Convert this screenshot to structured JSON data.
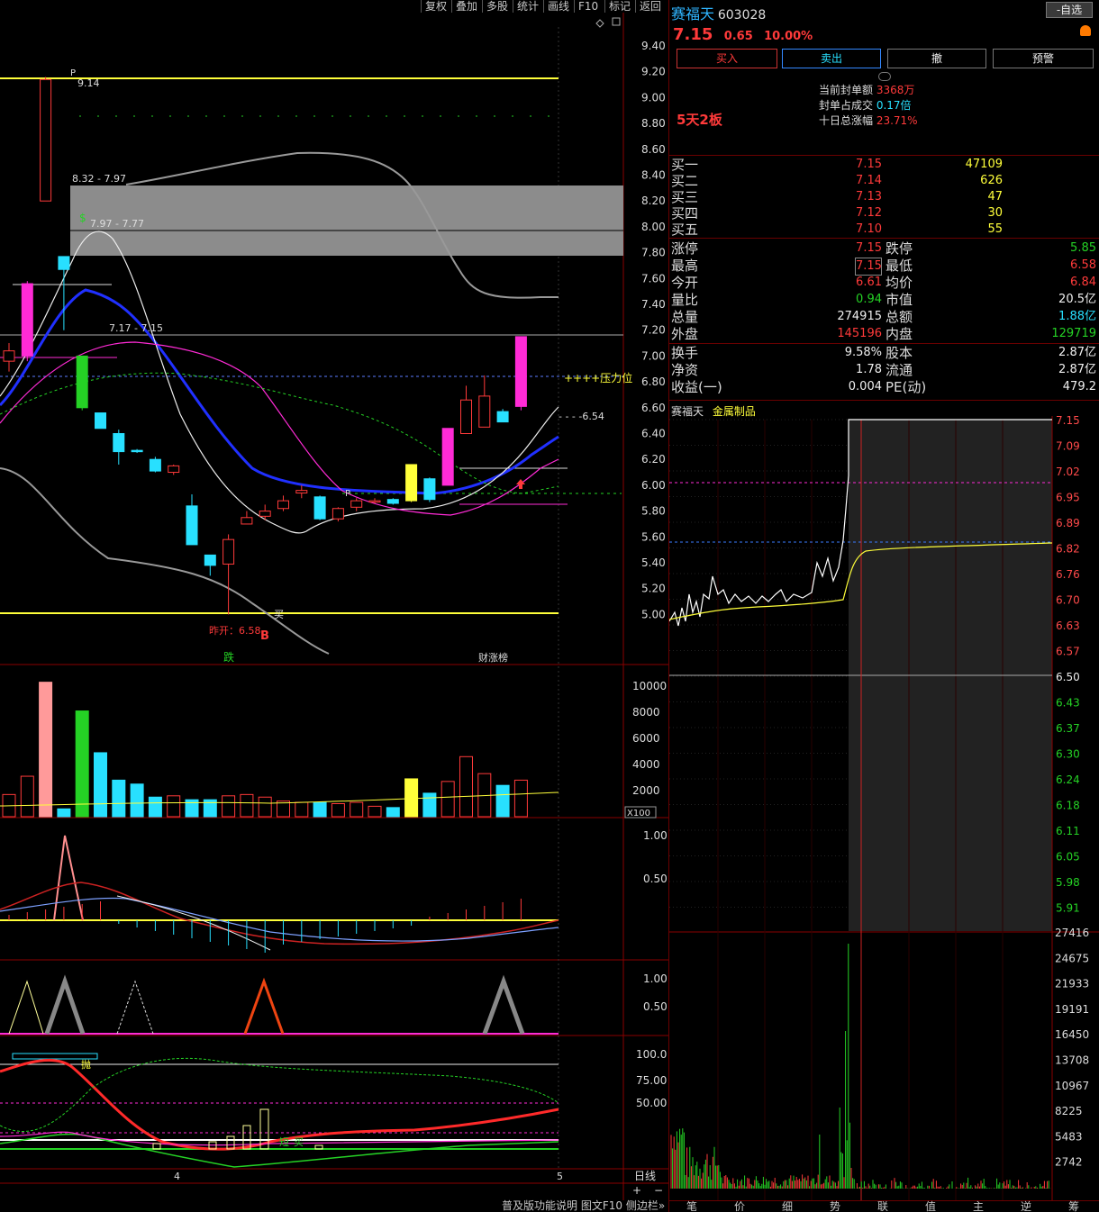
{
  "menu": [
    "复权",
    "叠加",
    "多股",
    "统计",
    "画线",
    "F10",
    "标记",
    "返回"
  ],
  "stock": {
    "name": "赛福天",
    "code": "603028",
    "price": "7.15",
    "change": "0.65",
    "change_pct": "10.00%",
    "self_select": "-自选",
    "board_tag": "5天2板",
    "industry": "金属制品"
  },
  "trade_buttons": [
    "买入",
    "卖出",
    "撤",
    "预警"
  ],
  "seal_info": [
    {
      "label": "当前封单额",
      "value": "3368万"
    },
    {
      "label": "封单占成交",
      "value": "0.17倍"
    },
    {
      "label": "十日总涨幅",
      "value": "23.71%"
    }
  ],
  "bids": [
    {
      "label": "买一",
      "price": "7.15",
      "vol": "47109"
    },
    {
      "label": "买二",
      "price": "7.14",
      "vol": "626"
    },
    {
      "label": "买三",
      "price": "7.13",
      "vol": "47"
    },
    {
      "label": "买四",
      "price": "7.12",
      "vol": "30"
    },
    {
      "label": "买五",
      "price": "7.10",
      "vol": "55"
    }
  ],
  "quote_rows": [
    {
      "l1": "涨停",
      "v1": "7.15",
      "l2": "跌停",
      "v2": "5.85"
    },
    {
      "l1": "最高",
      "v1": "7.15",
      "l2": "最低",
      "v2": "6.58"
    },
    {
      "l1": "今开",
      "v1": "6.61",
      "l2": "均价",
      "v2": "6.84"
    },
    {
      "l1": "量比",
      "v1": "0.94",
      "l2": "市值",
      "v2": "20.5亿"
    },
    {
      "l1": "总量",
      "v1": "274915",
      "l2": "总额",
      "v2": "1.88亿"
    },
    {
      "l1": "外盘",
      "v1": "145196",
      "l2": "内盘",
      "v2": "129719"
    }
  ],
  "fund_rows": [
    {
      "l1": "换手",
      "v1": "9.58%",
      "l2": "股本",
      "v2": "2.87亿"
    },
    {
      "l1": "净资",
      "v1": "1.78",
      "l2": "流通",
      "v2": "2.87亿"
    },
    {
      "l1": "收益(一)",
      "v1": "0.004",
      "l2": "PE(动)",
      "v2": "479.2"
    }
  ],
  "kline": {
    "price_axis": [
      "9.40",
      "9.20",
      "9.00",
      "8.80",
      "8.60",
      "8.40",
      "8.20",
      "8.00",
      "7.80",
      "7.60",
      "7.40",
      "7.20",
      "7.00",
      "6.80",
      "6.60",
      "6.40",
      "6.20",
      "6.00",
      "5.80",
      "5.60",
      "5.40",
      "5.20",
      "5.00"
    ],
    "annotations": {
      "high": "9.14",
      "zone1": "8.32 - 7.97",
      "zone2": "7.97 - 7.77",
      "zone3": "7.17 - 7.15",
      "pressure": "++++压力位",
      "support": "6.54",
      "prev_open": "昨开：6.58",
      "buy_mark": "买",
      "b_mark": "B",
      "fall_tag": "跌",
      "rise_tag": "财涨榜",
      "p_mark": "P",
      "dollar": "$"
    },
    "candles": [
      [
        6.96,
        7.04,
        7.1,
        6.88
      ],
      [
        7.0,
        7.56,
        7.58,
        6.96
      ],
      [
        8.2,
        9.14,
        9.16,
        8.2
      ],
      [
        7.77,
        7.67,
        7.77,
        7.2
      ],
      [
        7.0,
        6.6,
        7.0,
        6.58
      ],
      [
        6.56,
        6.44,
        6.56,
        6.44
      ],
      [
        6.4,
        6.26,
        6.43,
        6.16
      ],
      [
        6.27,
        6.26,
        6.28,
        6.25
      ],
      [
        6.2,
        6.11,
        6.22,
        6.1
      ],
      [
        6.1,
        6.15,
        6.16,
        6.08
      ],
      [
        5.84,
        5.54,
        5.93,
        5.54
      ],
      [
        5.46,
        5.38,
        5.46,
        5.3
      ],
      [
        5.39,
        5.58,
        5.62,
        5.0
      ],
      [
        5.7,
        5.75,
        5.8,
        5.7
      ],
      [
        5.76,
        5.8,
        5.85,
        5.73
      ],
      [
        5.82,
        5.88,
        5.92,
        5.8
      ],
      [
        5.94,
        5.96,
        6.0,
        5.9
      ],
      [
        5.91,
        5.74,
        5.92,
        5.73
      ],
      [
        5.74,
        5.82,
        5.83,
        5.72
      ],
      [
        5.83,
        5.88,
        5.9,
        5.8
      ],
      [
        5.88,
        5.88,
        5.9,
        5.86
      ],
      [
        5.89,
        5.86,
        5.9,
        5.85
      ],
      [
        5.88,
        6.16,
        6.16,
        5.87
      ],
      [
        6.05,
        5.89,
        6.06,
        5.87
      ],
      [
        6.0,
        6.44,
        6.44,
        6.0
      ],
      [
        6.4,
        6.66,
        6.77,
        6.4
      ],
      [
        6.45,
        6.69,
        6.85,
        6.45
      ],
      [
        6.57,
        6.49,
        6.59,
        6.49
      ],
      [
        6.61,
        7.15,
        7.15,
        6.58
      ]
    ],
    "volume_axis": [
      "10000",
      "8000",
      "6000",
      "4000",
      "2000"
    ],
    "volume_unit": "X100",
    "volumes": [
      1700,
      3100,
      10300,
      600,
      8100,
      4900,
      2800,
      2500,
      1500,
      1600,
      1300,
      1300,
      1600,
      1700,
      1500,
      1200,
      1100,
      1100,
      1000,
      1100,
      800,
      700,
      2900,
      1800,
      2700,
      4600,
      3300,
      2400,
      2800
    ],
    "ind1_axis": [
      "1.00",
      "0.50"
    ],
    "ind2_axis": [
      "1.00",
      "0.50"
    ],
    "ind3_axis": [
      "100.0",
      "75.00",
      "50.00"
    ],
    "ind3_labels": {
      "throw": "抛",
      "short": "短",
      "dip": "买"
    },
    "date_labels": [
      "4",
      "5"
    ],
    "period": "日线",
    "zoom": [
      "+",
      "−"
    ],
    "footer_links": [
      "普及版功能说明",
      "图文F10",
      "侧边栏»"
    ]
  },
  "intraday": {
    "axis": [
      "7.15",
      "7.09",
      "7.02",
      "6.95",
      "6.89",
      "6.82",
      "6.76",
      "6.70",
      "6.63",
      "6.57",
      "6.50",
      "6.43",
      "6.37",
      "6.30",
      "6.24",
      "6.18",
      "6.11",
      "6.05",
      "5.98",
      "5.91"
    ],
    "vol_axis": [
      "27416",
      "24675",
      "21933",
      "19191",
      "16450",
      "13708",
      "10967",
      "8225",
      "5483",
      "2742"
    ]
  },
  "bottom_tabs": [
    "笔",
    "价",
    "细",
    "势",
    "联",
    "值",
    "主",
    "逆",
    "筹"
  ],
  "colors": {
    "up": "#ff3a3a",
    "down": "#28e0ff",
    "magenta": "#ff2bd6",
    "yellow": "#ffff3a",
    "green": "#25d225"
  }
}
